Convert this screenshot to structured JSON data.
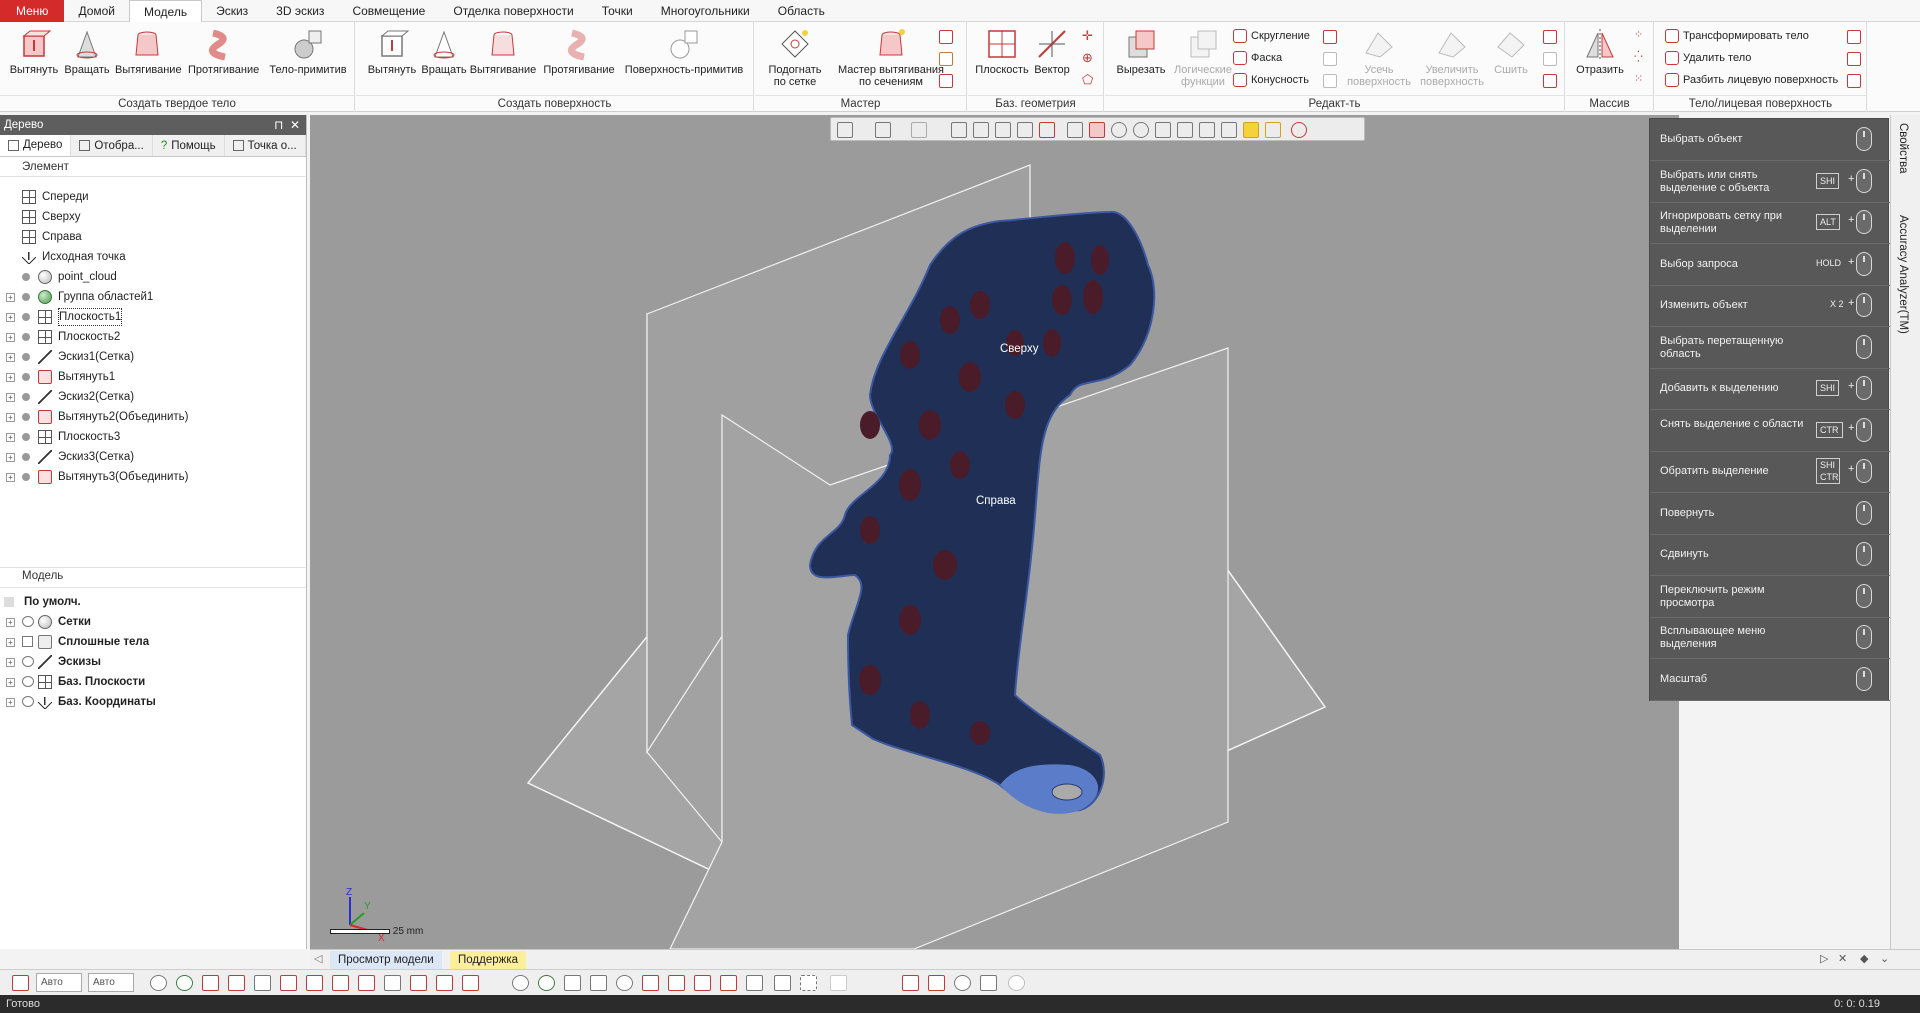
{
  "menu": {
    "tabs": [
      "Меню",
      "Домой",
      "Модель",
      "Эскиз",
      "3D эскиз",
      "Совмещение",
      "Отделка поверхности",
      "Точки",
      "Многоугольники",
      "Область"
    ],
    "active": "Модель"
  },
  "ribbon": {
    "solid": {
      "title": "Создать твердое тело",
      "buttons": [
        "Вытянуть",
        "Вращать",
        "Вытягивание",
        "Протягивание",
        "Тело-примитив"
      ]
    },
    "surface": {
      "title": "Создать поверхность",
      "buttons": [
        "Вытянуть",
        "Вращать",
        "Вытягивание",
        "Протягивание",
        "Поверхность-примитив"
      ]
    },
    "wizard": {
      "title": "Мастер",
      "btn1_l1": "Подогнать",
      "btn1_l2": "по сетке",
      "btn2_l1": "Мастер вытягивания",
      "btn2_l2": "по сечениям"
    },
    "refgeom": {
      "title": "Баз. геометрия",
      "buttons": [
        "Плоскость",
        "Вектор"
      ]
    },
    "edit": {
      "title": "Редакт-ть",
      "cut": "Вырезать",
      "boolean_l1": "Логические",
      "boolean_l2": "функции",
      "fillet": "Скругление",
      "chamfer": "Фаска",
      "draft": "Конусность",
      "trim_l1": "Усечь",
      "trim_l2": "поверхность",
      "extend_l1": "Увеличить",
      "extend_l2": "поверхность",
      "sew": "Сшить"
    },
    "array": {
      "title": "Массив",
      "mirror": "Отразить"
    },
    "body": {
      "title": "Тело/лицевая поверхность",
      "items": [
        "Трансформировать тело",
        "Удалить тело",
        "Разбить лицевую поверхность"
      ]
    }
  },
  "tree_panel": {
    "title": "Дерево",
    "tabs": [
      "Дерево",
      "Отобра...",
      "Помощь",
      "Точка о..."
    ],
    "section_header": "Элемент",
    "items": [
      {
        "label": "Спереди",
        "icon": "plane-icon"
      },
      {
        "label": "Сверху",
        "icon": "plane-icon"
      },
      {
        "label": "Справа",
        "icon": "plane-icon"
      },
      {
        "label": "Исходная точка",
        "icon": "origin-icon"
      },
      {
        "label": "point_cloud",
        "icon": "point-cloud-icon"
      },
      {
        "label": "Группа областей1",
        "icon": "region-group-icon"
      },
      {
        "label": "Плоскость1",
        "icon": "plane-icon"
      },
      {
        "label": "Плоскость2",
        "icon": "plane-icon"
      },
      {
        "label": "Эскиз1(Сетка)",
        "icon": "sketch-icon"
      },
      {
        "label": "Вытянуть1",
        "icon": "extrude-icon"
      },
      {
        "label": "Эскиз2(Сетка)",
        "icon": "sketch-icon"
      },
      {
        "label": "Вытянуть2(Объединить)",
        "icon": "extrude-icon"
      },
      {
        "label": "Плоскость3",
        "icon": "plane-icon"
      },
      {
        "label": "Эскиз3(Сетка)",
        "icon": "sketch-icon"
      },
      {
        "label": "Вытянуть3(Объединить)",
        "icon": "extrude-icon"
      }
    ],
    "model_header": "Модель",
    "model_items": [
      "По умолч.",
      "Сетки",
      "Сплошные тела",
      "Эскизы",
      "Баз. Плоскости",
      "Баз. Координаты"
    ]
  },
  "viewport": {
    "plane_label_top": "Сверху",
    "plane_label_right": "Справа",
    "scale": "25 mm",
    "axis_z": "Z",
    "axis_y": "Y",
    "axis_x": "X",
    "mesh_color": "#1f2f55",
    "background": "#9b9b9b"
  },
  "properties": {
    "rows": [
      {
        "label": "Выбрать объект",
        "key": ""
      },
      {
        "label": "Выбрать или снять выделение с объекта",
        "key": "SHI"
      },
      {
        "label": "Игнорировать сетку при выделении",
        "key": "ALT"
      },
      {
        "label": "Выбор запроса",
        "key": "HOLD"
      },
      {
        "label": "Изменить объект",
        "key": "X 2"
      },
      {
        "label": "Выбрать перетащенную область",
        "key": ""
      },
      {
        "label": "Добавить к выделению",
        "key": "SHI"
      },
      {
        "label": "Снять выделение с области",
        "key": "CTR"
      },
      {
        "label": "Обратить выделение",
        "key": "SHI CTR"
      },
      {
        "label": "Повернуть",
        "key": ""
      },
      {
        "label": "Сдвинуть",
        "key": ""
      },
      {
        "label": "Переключить режим просмотра",
        "key": ""
      },
      {
        "label": "Всплывающее меню выделения",
        "key": ""
      },
      {
        "label": "Масштаб",
        "key": ""
      }
    ]
  },
  "right_strip": {
    "tabs": [
      "Свойства",
      "Accuracy Analyzer(TM)"
    ]
  },
  "bottom_tabs": [
    "Просмотр модели",
    "Поддержка"
  ],
  "bottom_toolbar": {
    "combo1": "Авто",
    "combo2": "Авто"
  },
  "status": {
    "text": "Готово",
    "coords": "0: 0: 0.19"
  }
}
